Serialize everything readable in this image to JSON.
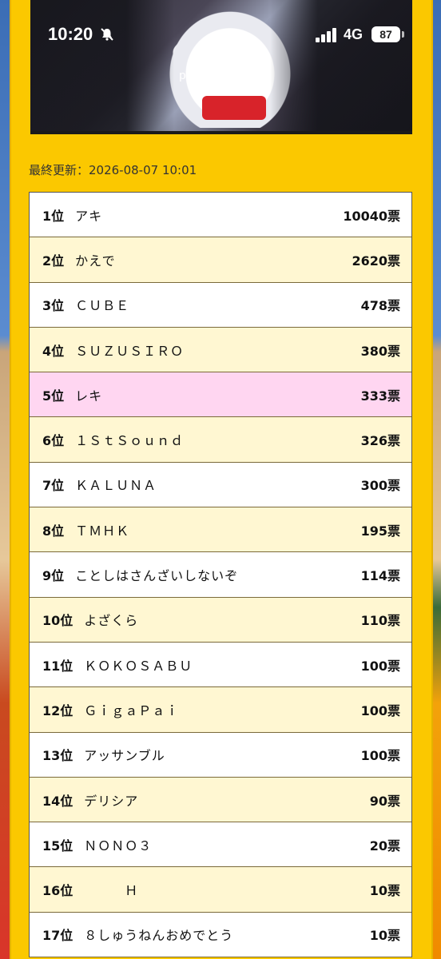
{
  "status_bar": {
    "time": "10:20",
    "network": "4G",
    "battery": "87"
  },
  "browser": {
    "url": "p.eagate.573.jp"
  },
  "page": {
    "last_updated": "最終更新：2026-08-07 10:01"
  },
  "ranking": [
    {
      "rank": "1位",
      "name": "アキ",
      "votes": "10040票",
      "style": "white"
    },
    {
      "rank": "2位",
      "name": "かえで",
      "votes": "2620票",
      "style": "cream"
    },
    {
      "rank": "3位",
      "name": "ＣＵＢＥ",
      "votes": "478票",
      "style": "white"
    },
    {
      "rank": "4位",
      "name": "ＳＵＺＵＳＩＲＯ",
      "votes": "380票",
      "style": "cream"
    },
    {
      "rank": "5位",
      "name": "レキ",
      "votes": "333票",
      "style": "pink"
    },
    {
      "rank": "6位",
      "name": "１ＳｔＳｏｕｎｄ",
      "votes": "326票",
      "style": "cream"
    },
    {
      "rank": "7位",
      "name": "ＫＡＬＵＮＡ",
      "votes": "300票",
      "style": "white"
    },
    {
      "rank": "8位",
      "name": "ＴＭＨＫ",
      "votes": "195票",
      "style": "cream"
    },
    {
      "rank": "9位",
      "name": "ことしはさんざいしないぞ",
      "votes": "114票",
      "style": "white"
    },
    {
      "rank": "10位",
      "name": "よざくら",
      "votes": "110票",
      "style": "cream"
    },
    {
      "rank": "11位",
      "name": "ＫＯＫＯＳＡＢＵ",
      "votes": "100票",
      "style": "white"
    },
    {
      "rank": "12位",
      "name": "ＧｉｇａＰａｉ",
      "votes": "100票",
      "style": "cream"
    },
    {
      "rank": "13位",
      "name": "アッサンブル",
      "votes": "100票",
      "style": "white"
    },
    {
      "rank": "14位",
      "name": "デリシア",
      "votes": "90票",
      "style": "cream"
    },
    {
      "rank": "15位",
      "name": "ＮＯＮＯ３",
      "votes": "20票",
      "style": "white"
    },
    {
      "rank": "16位",
      "name": "　　　Ｈ",
      "votes": "10票",
      "style": "cream"
    },
    {
      "rank": "17位",
      "name": "８しゅうねんおめでとう",
      "votes": "10票",
      "style": "white"
    }
  ]
}
